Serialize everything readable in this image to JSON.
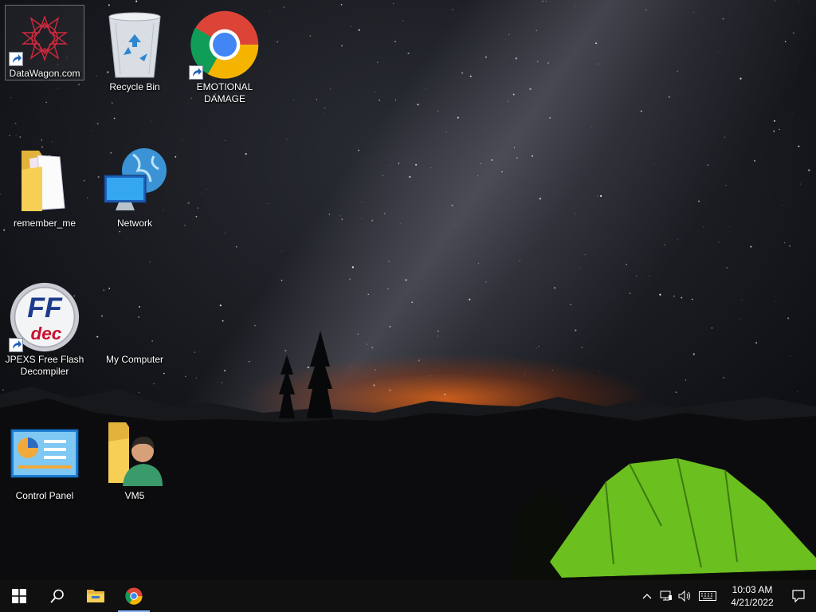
{
  "desktop": {
    "icons": [
      {
        "label": "DataWagon.com",
        "icon": "datawagon-icon",
        "shortcut": true
      },
      {
        "label": "Recycle Bin",
        "icon": "recycle-bin-icon",
        "shortcut": false
      },
      {
        "label": "EMOTIONAL DAMAGE",
        "icon": "chrome-icon",
        "shortcut": true
      },
      {
        "label": "remember_me",
        "icon": "folder-icon",
        "shortcut": false
      },
      {
        "label": "Network",
        "icon": "network-icon",
        "shortcut": false
      },
      {
        "label": "JPEXS Free Flash Decompiler",
        "icon": "ffdec-icon",
        "shortcut": true
      },
      {
        "label": "My Computer",
        "icon": "my-computer-icon",
        "shortcut": false
      },
      {
        "label": "Control Panel",
        "icon": "control-panel-icon",
        "shortcut": false
      },
      {
        "label": "VM5",
        "icon": "user-folder-icon",
        "shortcut": false
      }
    ],
    "ffdec_logo_top": "FF",
    "ffdec_logo_bottom": "dec"
  },
  "taskbar": {
    "buttons": [
      "start-icon",
      "search-icon",
      "file-explorer-icon",
      "chrome-icon"
    ],
    "active": "chrome-icon",
    "tray": [
      "chevron-up-icon",
      "network-icon",
      "volume-icon",
      "keyboard-icon"
    ],
    "time": "10:03 AM",
    "date": "4/21/2022",
    "colors": {
      "taskbar_bg": "#101010",
      "active_indicator": "#8ab4f8"
    }
  }
}
